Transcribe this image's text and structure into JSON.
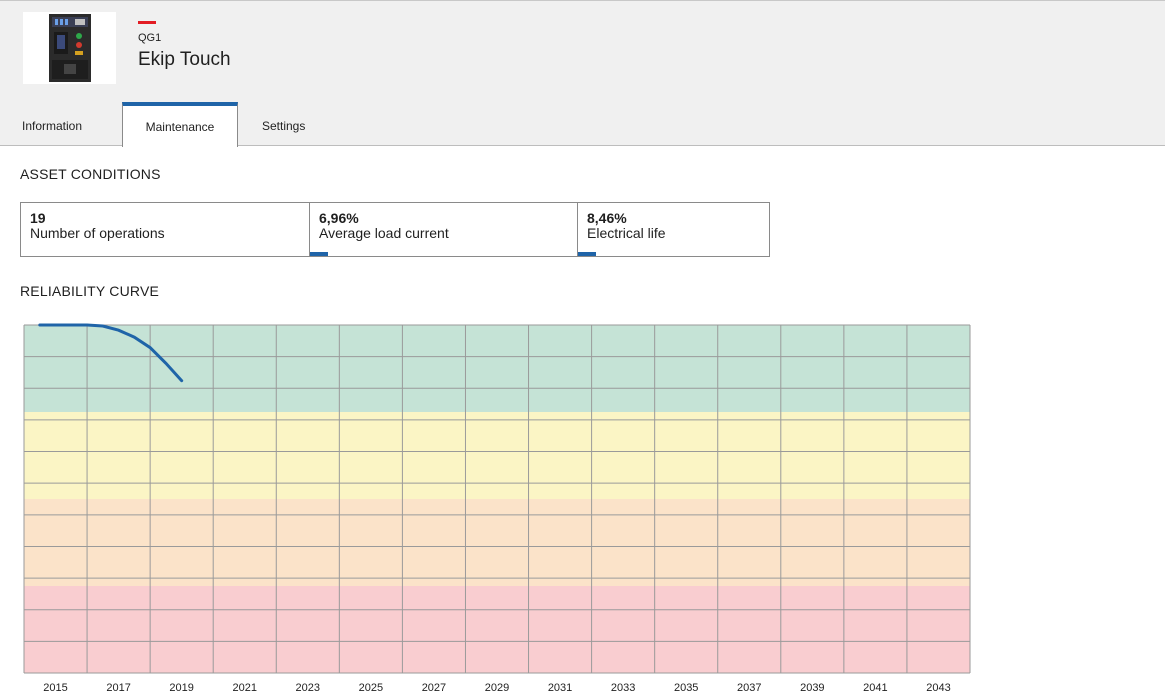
{
  "header": {
    "device_code": "QG1",
    "device_name": "Ekip Touch",
    "accent_color": "#e21c23",
    "device_image_icon": "circuit-breaker-image"
  },
  "tabs": [
    {
      "label": "Information",
      "active": false
    },
    {
      "label": "Maintenance",
      "active": true
    },
    {
      "label": "Settings",
      "active": false
    }
  ],
  "asset_conditions": {
    "title": "ASSET CONDITIONS",
    "cards": [
      {
        "value": "19",
        "label": "Number of operations"
      },
      {
        "value": "6,96%",
        "label": "Average load current",
        "level": 0.0696
      },
      {
        "value": "8,46%",
        "label": "Electrical life",
        "level": 0.0846
      }
    ]
  },
  "reliability": {
    "title": "RELIABILITY CURVE"
  },
  "chart_data": {
    "type": "line",
    "x_ticks": [
      "2015",
      "2017",
      "2019",
      "2021",
      "2023",
      "2025",
      "2027",
      "2029",
      "2031",
      "2033",
      "2035",
      "2037",
      "2039",
      "2041",
      "2043"
    ],
    "xlim": [
      2014,
      2044
    ],
    "ylim": [
      0,
      1
    ],
    "grid": true,
    "bands": [
      {
        "from": 0.75,
        "to": 1.0,
        "color": "#c5e3d6"
      },
      {
        "from": 0.5,
        "to": 0.75,
        "color": "#fbf5c5"
      },
      {
        "from": 0.25,
        "to": 0.5,
        "color": "#fbe3c9"
      },
      {
        "from": 0.0,
        "to": 0.25,
        "color": "#f9cdd0"
      }
    ],
    "series": [
      {
        "color": "#1f64a8",
        "x": [
          2014.5,
          2015,
          2016,
          2016.5,
          2017,
          2017.5,
          2018,
          2018.5,
          2019
        ],
        "y": [
          1.0,
          1.0,
          1.0,
          0.997,
          0.985,
          0.965,
          0.935,
          0.89,
          0.84
        ]
      }
    ]
  }
}
